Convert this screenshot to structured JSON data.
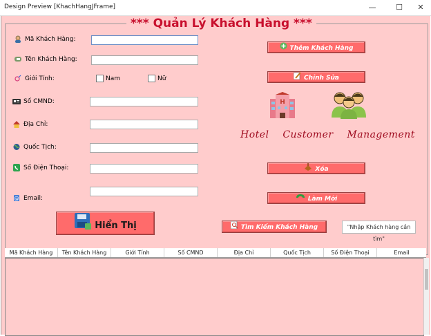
{
  "window": {
    "title": "Design Preview [KhachHangJFrame]",
    "minimize": "—",
    "maximize": "☐",
    "close": "✕"
  },
  "header": {
    "title": "*** Quản Lý Khách Hàng ***"
  },
  "form": {
    "ma_label": "Mã Khách Hàng:",
    "ten_label": "Tên Khách Hàng:",
    "gioitinh_label": "Giới Tính:",
    "nam_label": "Nam",
    "nu_label": "Nữ",
    "cmnd_label": "Số CMND:",
    "diachi_label": "Địa Chỉ:",
    "quoctich_label": "Quốc Tịch:",
    "sdt_label": "Số Điện Thoại:",
    "email_label": "Email:",
    "hienthi_label": "Hiển Thị"
  },
  "actions": {
    "them_label": "Thêm Khách Hàng",
    "chinhsua_label": "Chỉnh Sửa",
    "xoa_label": "Xóa",
    "lammoi_label": "Làm Mới",
    "timkiem_label": "Tìm Kiếm Khách Hàng",
    "search_text": "\"Nhập Khách hàng cần tìm\""
  },
  "banner": {
    "word1": "Hotel",
    "word2": "Customer",
    "word3": "Management"
  },
  "table": {
    "columns": [
      "Mã Khách Hàng",
      "Tên Khách Hàng",
      "Giới Tính",
      "Số CMND",
      "Địa Chỉ",
      "Quốc Tịch",
      "Số Điện Thoại",
      "Email"
    ]
  },
  "colors": {
    "background": "#ffcccc",
    "button": "#ff6b6b",
    "title": "#c8102e"
  }
}
